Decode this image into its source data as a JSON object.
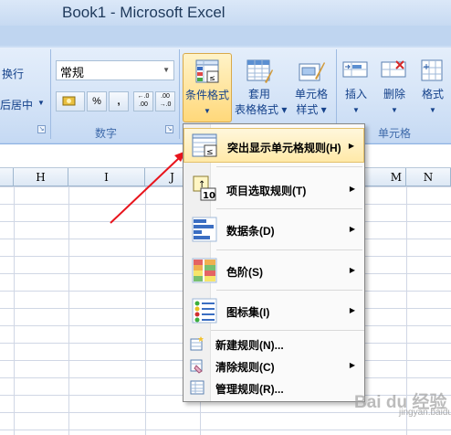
{
  "window": {
    "title": "Book1 - Microsoft Excel"
  },
  "ribbon": {
    "alignment": {
      "wrap_label": "换行",
      "merge_label": "后居中"
    },
    "number": {
      "format_value": "常规",
      "percent": "%",
      "comma": ",",
      "inc_decimal": "←.0 .00",
      "dec_decimal": ".00 →.0",
      "group_label": "数字"
    },
    "styles": {
      "conditional_format": "条件格式",
      "table_format_line1": "套用",
      "table_format_line2": "表格格式",
      "cell_styles_line1": "单元格",
      "cell_styles_line2": "样式"
    },
    "cells": {
      "insert": "插入",
      "delete": "删除",
      "format": "格式",
      "group_label": "单元格"
    }
  },
  "grid": {
    "columns": [
      "H",
      "I",
      "J",
      "M",
      "N"
    ]
  },
  "menu": {
    "items": [
      {
        "label": "突出显示单元格规则(H)",
        "submenu": true,
        "icon": "highlight-rules-icon"
      },
      {
        "label": "项目选取规则(T)",
        "submenu": true,
        "icon": "top-bottom-rules-icon"
      },
      {
        "label": "数据条(D)",
        "submenu": true,
        "icon": "data-bars-icon"
      },
      {
        "label": "色阶(S)",
        "submenu": true,
        "icon": "color-scales-icon"
      },
      {
        "label": "图标集(I)",
        "submenu": true,
        "icon": "icon-sets-icon"
      }
    ],
    "small_items": [
      {
        "label": "新建规则(N)...",
        "icon": "new-rule-icon"
      },
      {
        "label": "清除规则(C)",
        "submenu": true,
        "icon": "clear-rules-icon"
      },
      {
        "label": "管理规则(R)...",
        "icon": "manage-rules-icon"
      }
    ]
  },
  "watermark": {
    "brand": "Bai du 经验",
    "url": "jingyan.baidu.com"
  },
  "colors": {
    "highlight": "#ffe9a8",
    "ribbon": "#d5e4f7",
    "arrow": "#e8141c"
  }
}
